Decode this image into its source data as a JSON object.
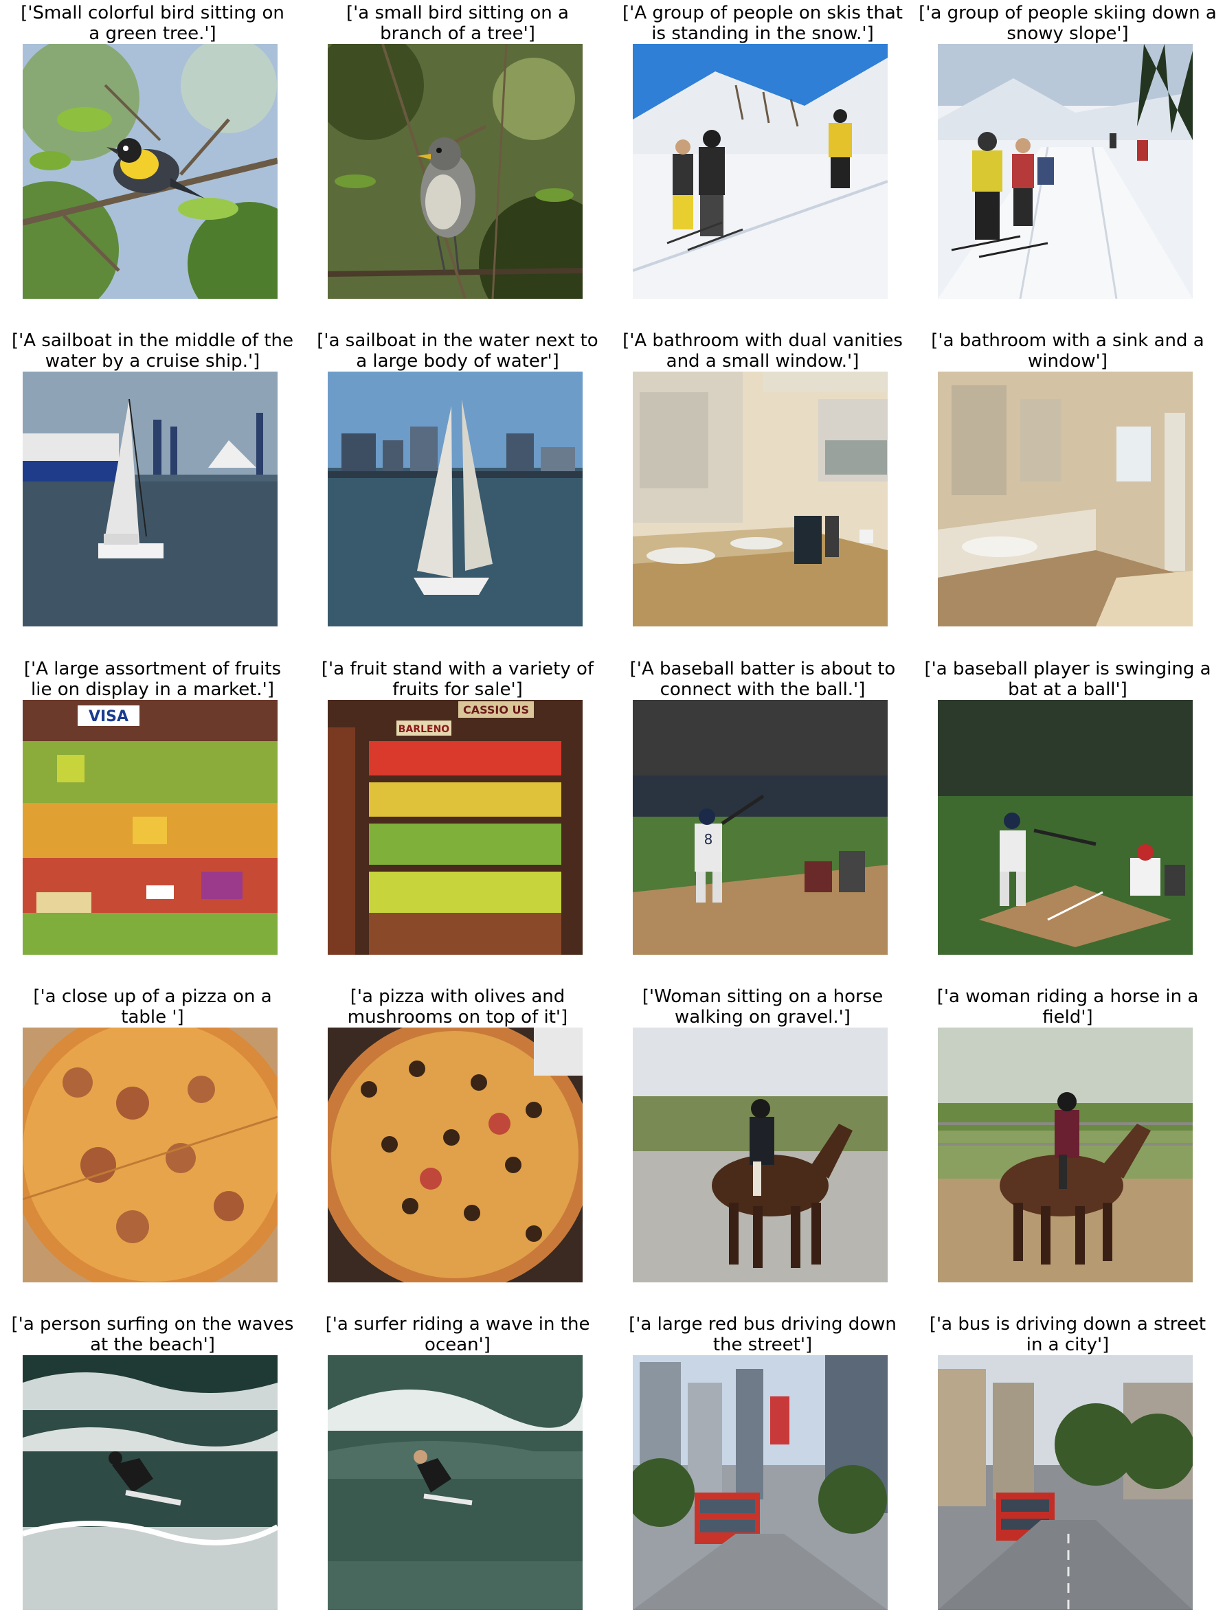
{
  "grid": [
    {
      "caption": "['Small colorful bird sitting on\na green tree.']",
      "scene": "bird1"
    },
    {
      "caption": "['a small bird sitting on a\nbranch of a tree']",
      "scene": "bird2"
    },
    {
      "caption": "['A group of people on skis that\nis standing in the snow.']",
      "scene": "ski1"
    },
    {
      "caption": "['a group of people skiing down a\nsnowy slope']",
      "scene": "ski2"
    },
    {
      "caption": "['A sailboat in the middle of the\nwater by a cruise ship.']",
      "scene": "sail1"
    },
    {
      "caption": "['a sailboat in the water next to\na large body of water']",
      "scene": "sail2"
    },
    {
      "caption": "['A bathroom with dual vanities\nand a small window.']",
      "scene": "bath1"
    },
    {
      "caption": "['a bathroom with a sink and a\nwindow']",
      "scene": "bath2"
    },
    {
      "caption": "['A large assortment of fruits\nlie on display in a market.']",
      "scene": "fruit1"
    },
    {
      "caption": "['a fruit stand with a variety of\nfruits for sale']",
      "scene": "fruit2"
    },
    {
      "caption": "['A baseball batter is about to\nconnect with the ball.']",
      "scene": "base1"
    },
    {
      "caption": "['a baseball player is swinging a\nbat at a ball']",
      "scene": "base2"
    },
    {
      "caption": "['a close up of a pizza on a\ntable ']",
      "scene": "pizza1"
    },
    {
      "caption": "['a pizza with olives and\nmushrooms on top of it']",
      "scene": "pizza2"
    },
    {
      "caption": "['Woman sitting on a horse\nwalking on gravel.']",
      "scene": "horse1"
    },
    {
      "caption": "['a woman riding a horse in a\nfield']",
      "scene": "horse2"
    },
    {
      "caption": "['a person surfing on the waves\nat the beach']",
      "scene": "surf1"
    },
    {
      "caption": "['a surfer riding a wave in the\nocean']",
      "scene": "surf2"
    },
    {
      "caption": "['a large red bus driving down\nthe street']",
      "scene": "bus1"
    },
    {
      "caption": "['a bus is driving down a street\nin a city']",
      "scene": "bus2"
    }
  ],
  "image_texts": {
    "fruit_sign_1": "VISA",
    "fruit_sign_2": "CASSIO US",
    "fruit_sign_3": "BARLENO",
    "jersey_number": "8"
  }
}
